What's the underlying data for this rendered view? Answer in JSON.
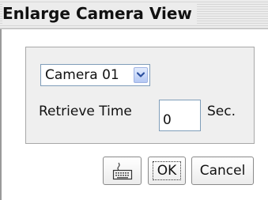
{
  "window": {
    "title": "Enlarge Camera View"
  },
  "camera": {
    "selected": "Camera 01"
  },
  "retrieve": {
    "label": "Retrieve Time",
    "value": "0",
    "unit": "Sec."
  },
  "buttons": {
    "keyboard_icon": "keyboard-icon",
    "ok_label": "OK",
    "cancel_label": "Cancel"
  },
  "colors": {
    "dropdown_accent": "#b4c8f4",
    "field_border": "#7f9db9",
    "panel_bg": "#efefef"
  }
}
